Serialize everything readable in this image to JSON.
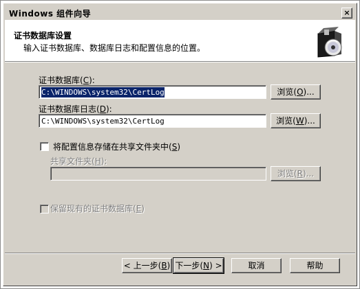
{
  "window": {
    "title": "Windows 组件向导",
    "close_glyph": "×"
  },
  "header": {
    "title": "证书数据库设置",
    "subtitle": "输入证书数据库、数据库日志和配置信息的位置。",
    "icon": "wizard-box-cd-icon"
  },
  "form": {
    "db_label": "证书数据库",
    "db_key": "C",
    "db_value": "C:\\WINDOWS\\system32\\CertLog",
    "db_browse_text": "浏览",
    "db_browse_key": "O",
    "log_label": "证书数据库日志",
    "log_key": "D",
    "log_value": "C:\\WINDOWS\\system32\\CertLog",
    "log_browse_text": "浏览",
    "log_browse_key": "W",
    "store_checkbox_label": "将配置信息存储在共享文件夹中",
    "store_checkbox_key": "S",
    "store_checked": false,
    "shared_folder_label": "共享文件夹",
    "shared_folder_key": "H",
    "shared_folder_value": "",
    "shared_browse_text": "浏览",
    "shared_browse_key": "R",
    "preserve_checkbox_label": "保留现有的证书数据库",
    "preserve_checkbox_key": "E",
    "preserve_checked": false
  },
  "footer": {
    "back_text": "< 上一步",
    "back_key": "B",
    "next_text": "下一步",
    "next_key": "N",
    "next_suffix": " >",
    "cancel_label": "取消",
    "help_label": "帮助"
  },
  "colors": {
    "dialog_bg": "#d4d0c8",
    "selection_bg": "#0a246a",
    "disabled_text": "#808080"
  }
}
